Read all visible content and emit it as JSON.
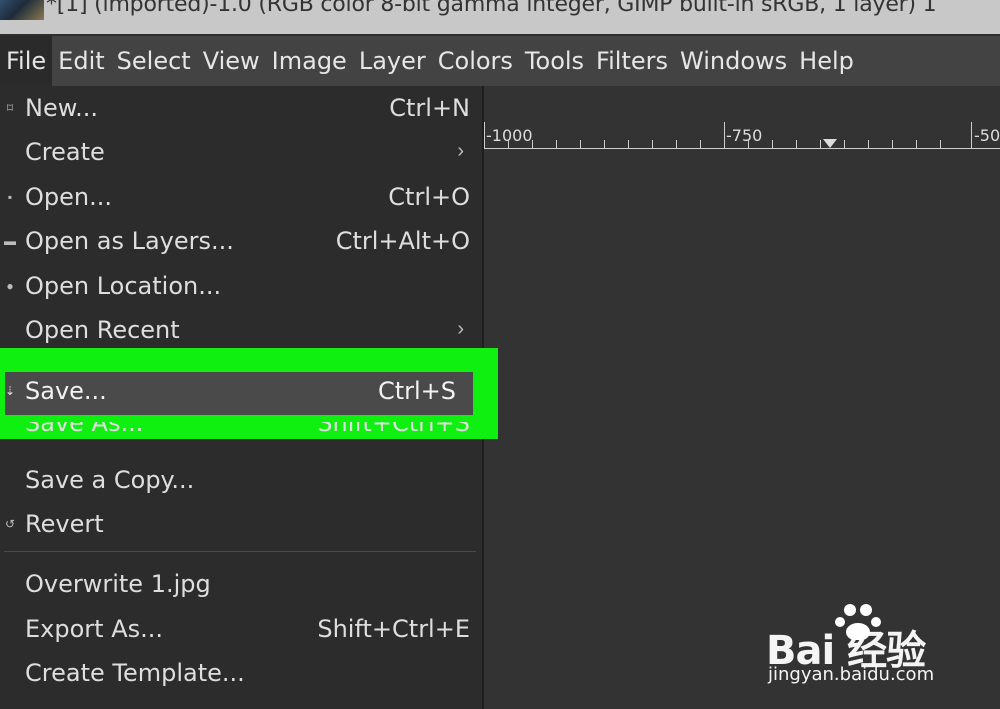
{
  "window": {
    "title": "*[1] (imported)-1.0 (RGB color 8-bit gamma integer, GIMP built-in sRGB, 1 layer) 1"
  },
  "menubar": {
    "items": [
      "File",
      "Edit",
      "Select",
      "View",
      "Image",
      "Layer",
      "Colors",
      "Tools",
      "Filters",
      "Windows",
      "Help"
    ],
    "active": "File"
  },
  "file_menu": {
    "new": {
      "label": "New...",
      "shortcut": "Ctrl+N",
      "icon": "new-image-icon"
    },
    "create": {
      "label": "Create",
      "icon": "submenu-arrow-icon"
    },
    "open": {
      "label": "Open...",
      "shortcut": "Ctrl+O",
      "icon": "open-image-icon"
    },
    "open_layers": {
      "label": "Open as Layers...",
      "shortcut": "Ctrl+Alt+O",
      "icon": "open-layers-icon"
    },
    "open_location": {
      "label": "Open Location...",
      "icon": "globe-icon"
    },
    "open_recent": {
      "label": "Open Recent",
      "icon": "submenu-arrow-icon"
    },
    "save": {
      "label": "Save...",
      "shortcut": "Ctrl+S",
      "icon": "save-icon"
    },
    "save_as": {
      "label": "Save As...",
      "shortcut": "Shift+Ctrl+S"
    },
    "save_copy": {
      "label": "Save a Copy..."
    },
    "revert": {
      "label": "Revert",
      "icon": "revert-icon"
    },
    "overwrite": {
      "label": "Overwrite 1.jpg"
    },
    "export_as": {
      "label": "Export As...",
      "shortcut": "Shift+Ctrl+E"
    },
    "create_template": {
      "label": "Create Template..."
    }
  },
  "ruler": {
    "labels": [
      "-1000",
      "-750",
      "-50"
    ]
  },
  "watermark": {
    "brand": "Bai  经验",
    "site": "jingyan.baidu.com"
  },
  "colors": {
    "highlight": "#10f010",
    "menu_bg": "#2c2c2c",
    "menubar_bg": "#434343",
    "canvas_bg": "#333333"
  }
}
